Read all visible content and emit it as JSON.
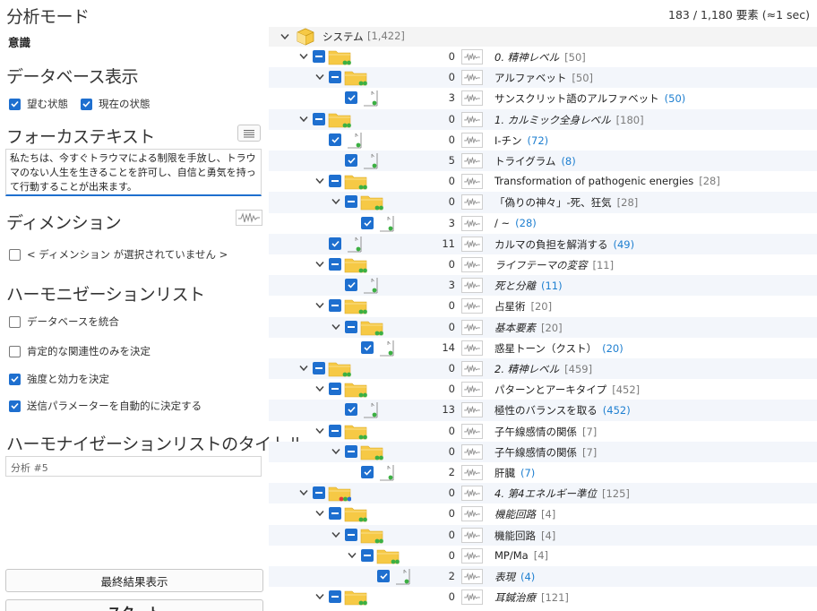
{
  "left": {
    "mode_title": "分析モード",
    "mode_value": "意識",
    "db_title": "データベース表示",
    "db_checks": [
      {
        "label": "望む状態",
        "checked": true
      },
      {
        "label": "現在の状態",
        "checked": true
      }
    ],
    "focus_title": "フォーカステキスト",
    "focus_text": "私たちは、今すぐトラウマによる制限を手放し、トラウマのない人生を生きることを許可し、自信と勇気を持って行動することが出来ます。",
    "dimension_title": "ディメンション",
    "dimension_check": {
      "label": "< ディメンション が選択されていません >",
      "checked": false
    },
    "harmonization_title": "ハーモニゼーションリスト",
    "harmonization_checks": [
      {
        "label": "データベースを統合",
        "checked": false
      },
      {
        "label": "肯定的な関連性のみを決定",
        "checked": false
      },
      {
        "label": "強度と効力を決定",
        "checked": true
      },
      {
        "label": "送信パラメーターを自動的に決定する",
        "checked": true
      }
    ],
    "list_title_heading": "ハーモナイゼーションリストのタイトル",
    "list_title_value": "分析 #5",
    "final_button": "最終結果表示",
    "start_button": "スタート"
  },
  "right": {
    "stats": "183 / 1,180 要素 (≈1 sec)",
    "root": {
      "label": "システム",
      "count": "[1,422]"
    },
    "rows": [
      {
        "kind": "folder",
        "indent": 0,
        "count": "0",
        "label": "0. 精神レベル",
        "num": "[50]",
        "italic": true,
        "blue": false,
        "dots": "g"
      },
      {
        "kind": "folder",
        "indent": 1,
        "count": "0",
        "label": "アルファベット",
        "num": "[50]",
        "italic": false,
        "blue": false,
        "dots": "g"
      },
      {
        "kind": "leaf",
        "indent": 2,
        "count": "3",
        "label": "サンスクリット語のアルファベット",
        "num": "(50)",
        "italic": false,
        "blue": true,
        "dots": "g"
      },
      {
        "kind": "folder",
        "indent": 0,
        "count": "0",
        "label": "1. カルミック全身レベル",
        "num": "[180]",
        "italic": true,
        "blue": false,
        "dots": "g"
      },
      {
        "kind": "leaf",
        "indent": 1,
        "count": "0",
        "label": "I-チン",
        "num": "(72)",
        "italic": false,
        "blue": true,
        "dots": "g"
      },
      {
        "kind": "leaf",
        "indent": 2,
        "count": "5",
        "label": "トライグラム",
        "num": "(8)",
        "italic": false,
        "blue": true,
        "dots": "g"
      },
      {
        "kind": "folder",
        "indent": 1,
        "count": "0",
        "label": "Transformation of pathogenic energies",
        "num": "[28]",
        "italic": false,
        "blue": false,
        "dots": "g"
      },
      {
        "kind": "folder",
        "indent": 2,
        "count": "0",
        "label": "「偽りの神々」-死、狂気",
        "num": "[28]",
        "italic": false,
        "blue": false,
        "dots": "g"
      },
      {
        "kind": "leaf",
        "indent": 3,
        "count": "3",
        "label": "/ ~",
        "num": "(28)",
        "italic": false,
        "blue": true,
        "dots": "g"
      },
      {
        "kind": "leaf",
        "indent": 1,
        "count": "11",
        "label": "カルマの負担を解消する",
        "num": "(49)",
        "italic": false,
        "blue": true,
        "dots": "g"
      },
      {
        "kind": "folder",
        "indent": 1,
        "count": "0",
        "label": "ライフテーマの変容",
        "num": "[11]",
        "italic": true,
        "blue": false,
        "dots": "g"
      },
      {
        "kind": "leaf",
        "indent": 2,
        "count": "3",
        "label": "死と分離",
        "num": "(11)",
        "italic": true,
        "blue": true,
        "dots": "g"
      },
      {
        "kind": "folder",
        "indent": 1,
        "count": "0",
        "label": "占星術",
        "num": "[20]",
        "italic": false,
        "blue": false,
        "dots": "g"
      },
      {
        "kind": "folder",
        "indent": 2,
        "count": "0",
        "label": "基本要素",
        "num": "[20]",
        "italic": true,
        "blue": false,
        "dots": "g"
      },
      {
        "kind": "leaf",
        "indent": 3,
        "count": "14",
        "label": "惑星トーン（クスト）",
        "num": "(20)",
        "italic": false,
        "blue": true,
        "dots": "g"
      },
      {
        "kind": "folder",
        "indent": 0,
        "count": "0",
        "label": "2. 精神レベル",
        "num": "[459]",
        "italic": true,
        "blue": false,
        "dots": "g"
      },
      {
        "kind": "folder",
        "indent": 1,
        "count": "0",
        "label": "パターンとアーキタイプ",
        "num": "[452]",
        "italic": false,
        "blue": false,
        "dots": "g"
      },
      {
        "kind": "leaf",
        "indent": 2,
        "count": "13",
        "label": "極性のバランスを取る",
        "num": "(452)",
        "italic": false,
        "blue": true,
        "dots": "g"
      },
      {
        "kind": "folder",
        "indent": 1,
        "count": "0",
        "label": "子午線感情の関係",
        "num": "[7]",
        "italic": false,
        "blue": false,
        "dots": "g"
      },
      {
        "kind": "folder",
        "indent": 2,
        "count": "0",
        "label": "子午線感情の関係",
        "num": "[7]",
        "italic": false,
        "blue": false,
        "dots": "g"
      },
      {
        "kind": "leaf",
        "indent": 3,
        "count": "2",
        "label": "肝臓",
        "num": "(7)",
        "italic": false,
        "blue": true,
        "dots": "g"
      },
      {
        "kind": "folder",
        "indent": 0,
        "count": "0",
        "label": "4. 第4エネルギー準位",
        "num": "[125]",
        "italic": true,
        "blue": false,
        "dots": "rgb"
      },
      {
        "kind": "folder",
        "indent": 1,
        "count": "0",
        "label": "機能回路",
        "num": "[4]",
        "italic": true,
        "blue": false,
        "dots": "g"
      },
      {
        "kind": "folder",
        "indent": 2,
        "count": "0",
        "label": "機能回路",
        "num": "[4]",
        "italic": false,
        "blue": false,
        "dots": "g"
      },
      {
        "kind": "folder",
        "indent": 3,
        "count": "0",
        "label": "MP/Ma",
        "num": "[4]",
        "italic": false,
        "blue": false,
        "dots": "g"
      },
      {
        "kind": "leaf",
        "indent": 4,
        "count": "2",
        "label": "表現",
        "num": "(4)",
        "italic": true,
        "blue": true,
        "dots": "g"
      },
      {
        "kind": "folder",
        "indent": 1,
        "count": "0",
        "label": "耳鍼治療",
        "num": "[121]",
        "italic": true,
        "blue": false,
        "dots": "g"
      }
    ]
  },
  "colors": {
    "accent": "#1e6fcf",
    "folder": "#f6c945",
    "dot_green": "#3cb043",
    "dot_red": "#e23b3b",
    "dot_blue": "#2b6fd6"
  }
}
